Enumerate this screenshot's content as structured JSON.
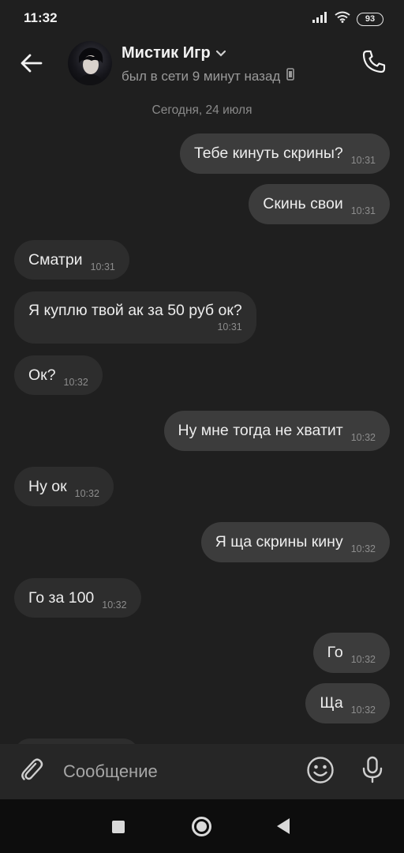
{
  "status_bar": {
    "time": "11:32",
    "battery": "93"
  },
  "header": {
    "contact_name": "Мистик Игр",
    "contact_status": "был в сети 9 минут назад"
  },
  "chat": {
    "date_separator": "Сегодня, 24 июля",
    "messages": [
      {
        "direction": "out",
        "text": "Тебе кинуть скрины?",
        "time": "10:31"
      },
      {
        "direction": "out",
        "text": "Скинь свои",
        "time": "10:31"
      },
      {
        "direction": "in",
        "text": "Сматри",
        "time": "10:31"
      },
      {
        "direction": "in",
        "text": "Я куплю твой ак за 50 руб ок?",
        "time": "10:31"
      },
      {
        "direction": "in",
        "text": "Ок?",
        "time": "10:32"
      },
      {
        "direction": "out",
        "text": "Ну мне тогда не хватит",
        "time": "10:32"
      },
      {
        "direction": "in",
        "text": "Ну ок",
        "time": "10:32"
      },
      {
        "direction": "out",
        "text": "Я ща скрины кину",
        "time": "10:32"
      },
      {
        "direction": "in",
        "text": "Го за 100",
        "time": "10:32"
      },
      {
        "direction": "out",
        "text": "Го",
        "time": "10:32"
      },
      {
        "direction": "out",
        "text": "Ща",
        "time": "10:32"
      }
    ]
  },
  "composer": {
    "placeholder": "Сообщение"
  },
  "colors": {
    "background": "#1f1f1f",
    "bubble_out": "#3c3c3c",
    "bubble_in": "#2d2d2d",
    "composer": "#262626",
    "navbar": "#0d0d0d"
  },
  "icons": {
    "back": "arrow-left-icon",
    "call": "phone-icon",
    "attach": "paperclip-icon",
    "emoji": "smiley-icon",
    "mic": "microphone-icon",
    "mobile": "mobile-device-icon",
    "dropdown": "chevron-down-icon"
  }
}
